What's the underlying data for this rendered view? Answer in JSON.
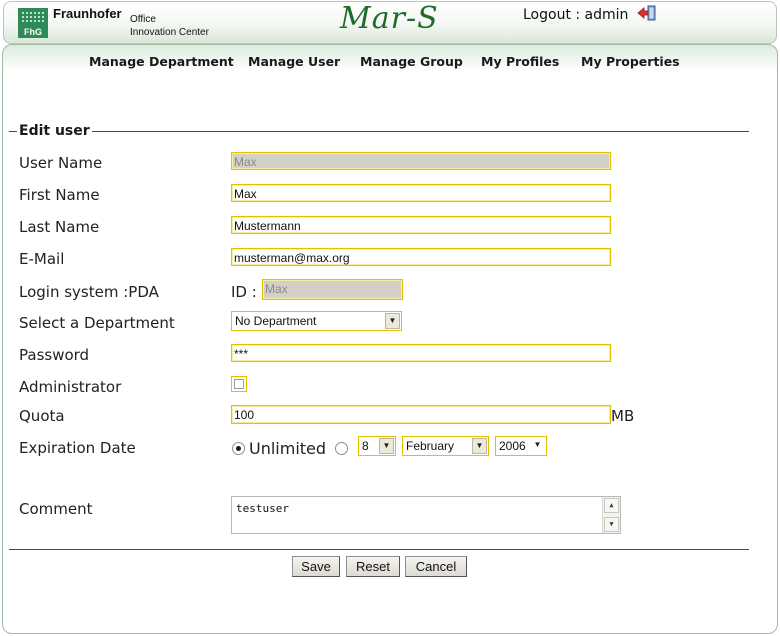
{
  "header": {
    "brand_name": "Fraunhofer",
    "brand_office": "Office",
    "brand_center": "Innovation Center",
    "logo_text": "FhG",
    "app_title": "Mar-S",
    "logout_text": "Logout : admin"
  },
  "nav": {
    "items": [
      {
        "label": "Manage Department"
      },
      {
        "label": "Manage User"
      },
      {
        "label": "Manage Group"
      },
      {
        "label": "My Profiles"
      },
      {
        "label": "My Properties"
      }
    ]
  },
  "form": {
    "legend": "Edit user",
    "user_name": {
      "label": "User Name",
      "value": "Max"
    },
    "first_name": {
      "label": "First Name",
      "value": "Max"
    },
    "last_name": {
      "label": "Last Name",
      "value": "Mustermann"
    },
    "email": {
      "label": "E-Mail",
      "value": "musterman@max.org"
    },
    "login_system": {
      "label": "Login system :PDA",
      "id_label": "ID :",
      "value": "Max"
    },
    "department": {
      "label": "Select a Department",
      "value": "No Department"
    },
    "password": {
      "label": "Password",
      "value": "***"
    },
    "administrator": {
      "label": "Administrator",
      "checked": false
    },
    "quota": {
      "label": "Quota",
      "value": "100",
      "unit": "MB"
    },
    "expiration": {
      "label": "Expiration Date",
      "unlimited_label": "Unlimited",
      "unlimited_selected": true,
      "day": "8",
      "month": "February",
      "year": "2006"
    },
    "comment": {
      "label": "Comment",
      "value": "testuser"
    }
  },
  "buttons": {
    "save": "Save",
    "reset": "Reset",
    "cancel": "Cancel"
  },
  "colors": {
    "accent_green": "#1f6b2c",
    "field_border": "#e0c200",
    "disabled_field": "#d4d0c8"
  }
}
